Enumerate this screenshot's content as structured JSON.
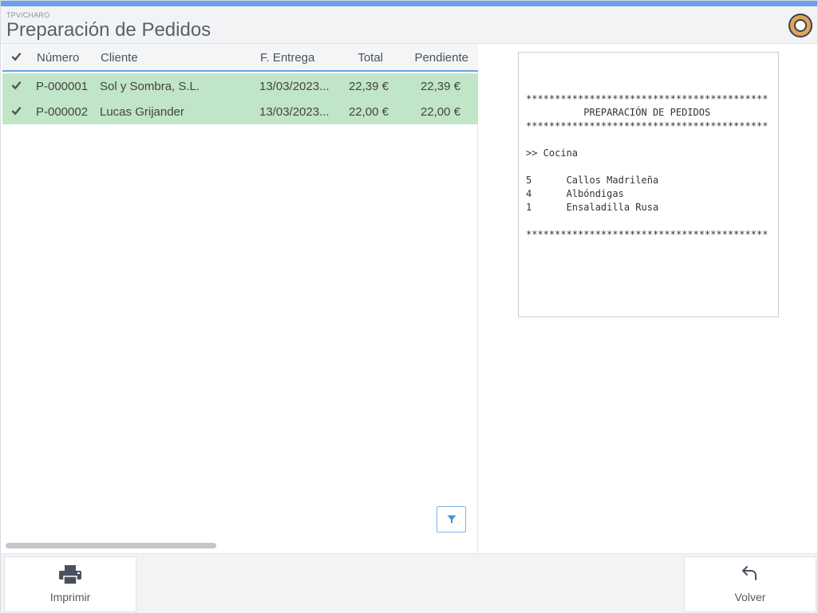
{
  "header": {
    "breadcrumb": "TPV/CHARO",
    "title": "Preparación de Pedidos",
    "logo_icon": "pot-icon"
  },
  "grid": {
    "columns": {
      "check": "check-icon",
      "numero": "Número",
      "cliente": "Cliente",
      "fecha": "F. Entrega",
      "total": "Total",
      "pendiente": "Pendiente"
    },
    "rows": [
      {
        "numero": "P-000001",
        "cliente": "Sol y Sombra, S.L.",
        "fecha": "13/03/2023...",
        "total": "22,39 €",
        "pendiente": "22,39 €"
      },
      {
        "numero": "P-000002",
        "cliente": "Lucas Grijander",
        "fecha": "13/03/2023...",
        "total": "22,00 €",
        "pendiente": "22,00 €"
      }
    ],
    "row_color": "#c1e5c7",
    "filter_icon": "filter-icon"
  },
  "ticket": {
    "text": "******************************************\n          PREPARACIÓN DE PEDIDOS\n******************************************\n\n>> Cocina\n\n5      Callos Madrileña\n4      Albóndigas\n1      Ensaladilla Rusa\n\n******************************************"
  },
  "footer": {
    "print_label": "Imprimir",
    "print_icon": "printer-icon",
    "back_label": "Volver",
    "back_icon": "undo-arrow-icon"
  },
  "colors": {
    "accent": "#6aa0e8",
    "selected_row": "#c1e5c7"
  }
}
